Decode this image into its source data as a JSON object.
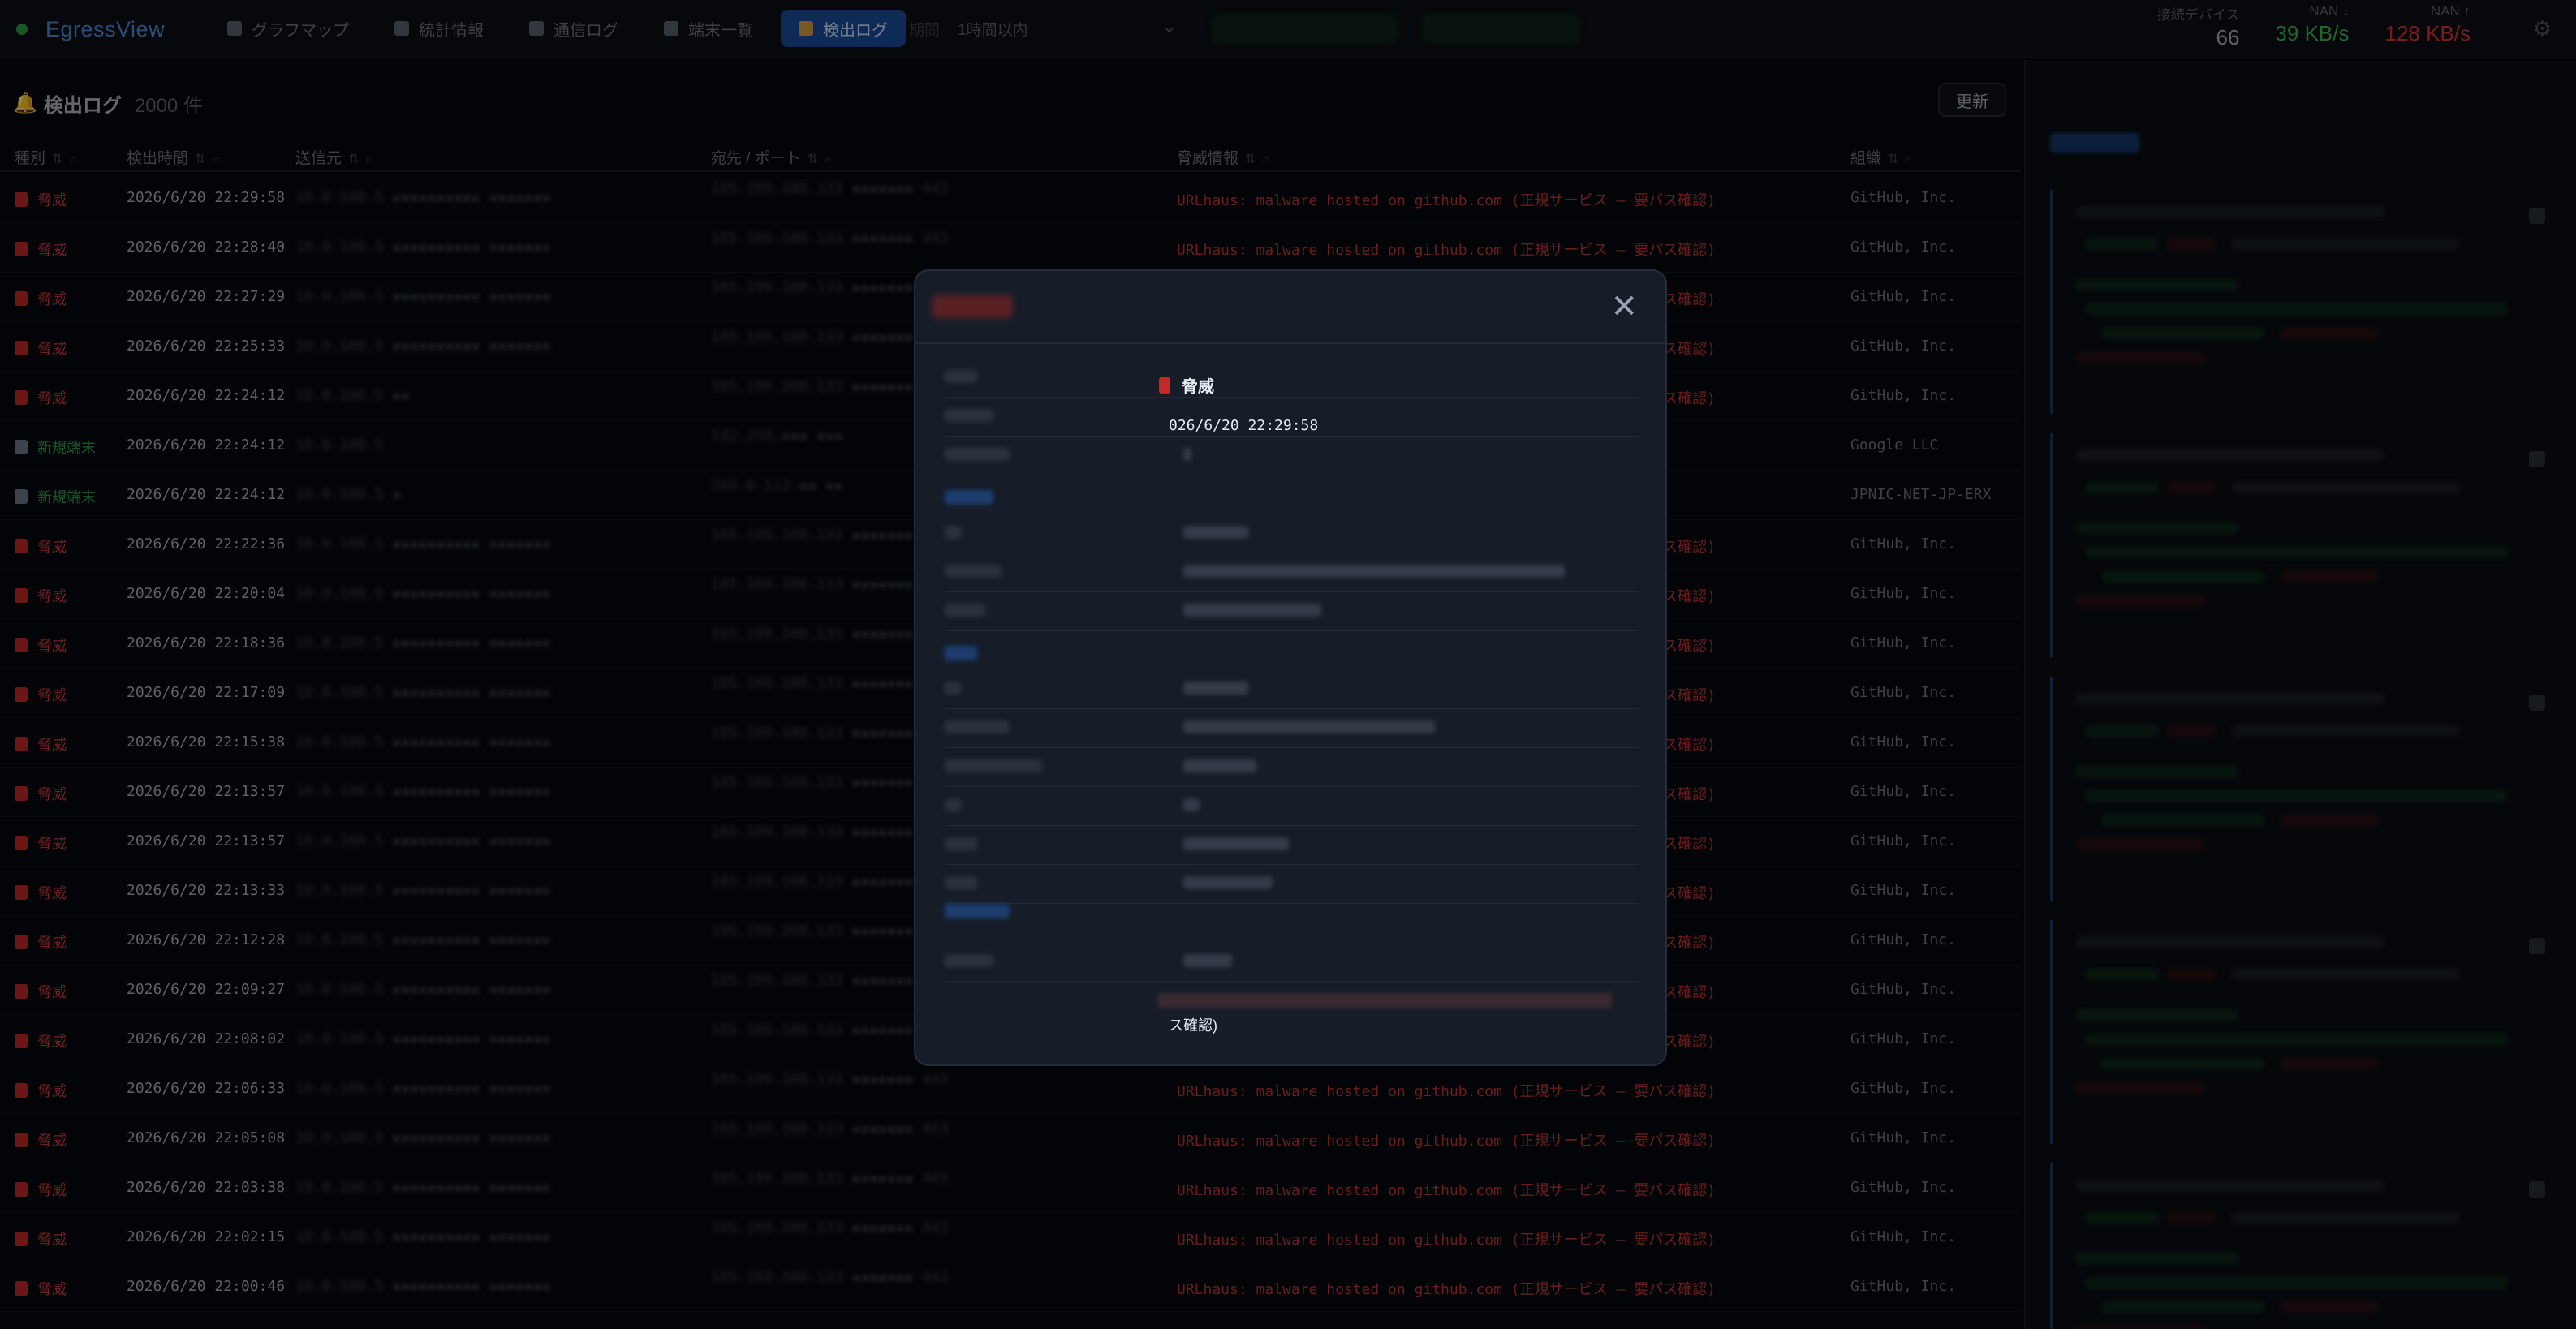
{
  "app": {
    "name": "EgressView"
  },
  "nav": {
    "tabs": [
      {
        "label": "グラフマップ",
        "active": false
      },
      {
        "label": "統計情報",
        "active": false
      },
      {
        "label": "通信ログ",
        "active": false
      },
      {
        "label": "端末一覧",
        "active": false
      },
      {
        "label": "検出ログ",
        "active": true
      }
    ],
    "period_label": "期間",
    "period_value": "1時間以内"
  },
  "stats": {
    "devices_label": "接続デバイス",
    "devices_value": "66",
    "down_label": "NAN ↓",
    "down_value": "39 KB/s",
    "up_label": "NAN ↑",
    "up_value": "128 KB/s",
    "colors": {
      "down": "#3fb950",
      "up": "#da3633"
    }
  },
  "log": {
    "title": "検出ログ",
    "count": "2000 件",
    "refresh_label": "更新",
    "columns": [
      "種別",
      "検出時間",
      "送信元",
      "宛先 / ポート",
      "脅威情報",
      "組織"
    ],
    "rows": [
      {
        "type": "脅威",
        "kind": "threat",
        "time": "2026/6/20 22:29:58",
        "src": "10.0.100.5 ▪▪▪▪▪▪▪▪▪▪ ▪▪▪▪▪▪▪",
        "dst": "185.199.108.133 ▪▪▪▪▪▪▪ 443",
        "info": "URLhaus: malware hosted on github.com (正規サービス ― 要パス確認)",
        "org": "GitHub, Inc."
      },
      {
        "type": "脅威",
        "kind": "threat",
        "time": "2026/6/20 22:28:40",
        "src": "10.0.100.5 ▪▪▪▪▪▪▪▪▪▪ ▪▪▪▪▪▪▪",
        "dst": "185.199.108.133 ▪▪▪▪▪▪▪ 443",
        "info": "URLhaus: malware hosted on github.com (正規サービス ― 要パス確認)",
        "org": "GitHub, Inc."
      },
      {
        "type": "脅威",
        "kind": "threat",
        "time": "2026/6/20 22:27:29",
        "src": "10.0.100.5 ▪▪▪▪▪▪▪▪▪▪ ▪▪▪▪▪▪▪",
        "dst": "185.199.108.133 ▪▪▪▪▪▪▪ 443",
        "info": "URLhaus: malware hosted on github.com (正規サービス ― 要パス確認)",
        "org": "GitHub, Inc."
      },
      {
        "type": "脅威",
        "kind": "threat",
        "time": "2026/6/20 22:25:33",
        "src": "10.0.100.5 ▪▪▪▪▪▪▪▪▪▪ ▪▪▪▪▪▪▪",
        "dst": "185.199.108.133 ▪▪▪▪▪▪▪ 443",
        "info": "URLhaus: malware hosted on github.com (正規サービス ― 要パス確認)",
        "org": "GitHub, Inc."
      },
      {
        "type": "脅威",
        "kind": "threat",
        "time": "2026/6/20 22:24:12",
        "src": "10.0.100.5 ▪▪",
        "dst": "185.199.108.133 ▪▪▪▪▪▪▪ 443",
        "info": "URLhaus: malware hosted on github.com (正規サービス ― 要パス確認)",
        "org": "GitHub, Inc."
      },
      {
        "type": "新規端末",
        "kind": "new",
        "time": "2026/6/20 22:24:12",
        "src": "10.0.100.5",
        "dst": "142.250.▪▪▪ ▪▪▪",
        "info": "",
        "org": "Google LLC"
      },
      {
        "type": "新規端末",
        "kind": "new",
        "time": "2026/6/20 22:24:12",
        "src": "10.0.100.5 ▪",
        "dst": "203.0.113.▪▪ ▪▪",
        "info": "",
        "org": "JPNIC-NET-JP-ERX"
      },
      {
        "type": "脅威",
        "kind": "threat",
        "time": "2026/6/20 22:22:36",
        "src": "10.0.100.5 ▪▪▪▪▪▪▪▪▪▪ ▪▪▪▪▪▪▪",
        "dst": "185.199.108.133 ▪▪▪▪▪▪▪ 443",
        "info": "URLhaus: malware hosted on github.com (正規サービス ― 要パス確認)",
        "org": "GitHub, Inc."
      },
      {
        "type": "脅威",
        "kind": "threat",
        "time": "2026/6/20 22:20:04",
        "src": "10.0.100.5 ▪▪▪▪▪▪▪▪▪▪ ▪▪▪▪▪▪▪",
        "dst": "185.199.108.133 ▪▪▪▪▪▪▪ 443",
        "info": "URLhaus: malware hosted on github.com (正規サービス ― 要パス確認)",
        "org": "GitHub, Inc."
      },
      {
        "type": "脅威",
        "kind": "threat",
        "time": "2026/6/20 22:18:36",
        "src": "10.0.100.5 ▪▪▪▪▪▪▪▪▪▪ ▪▪▪▪▪▪▪",
        "dst": "185.199.108.133 ▪▪▪▪▪▪▪ 443",
        "info": "URLhaus: malware hosted on github.com (正規サービス ― 要パス確認)",
        "org": "GitHub, Inc."
      },
      {
        "type": "脅威",
        "kind": "threat",
        "time": "2026/6/20 22:17:09",
        "src": "10.0.100.5 ▪▪▪▪▪▪▪▪▪▪ ▪▪▪▪▪▪▪",
        "dst": "185.199.108.133 ▪▪▪▪▪▪▪ 443",
        "info": "URLhaus: malware hosted on github.com (正規サービス ― 要パス確認)",
        "org": "GitHub, Inc."
      },
      {
        "type": "脅威",
        "kind": "threat",
        "time": "2026/6/20 22:15:38",
        "src": "10.0.100.5 ▪▪▪▪▪▪▪▪▪▪ ▪▪▪▪▪▪▪",
        "dst": "185.199.108.133 ▪▪▪▪▪▪▪ 443",
        "info": "URLhaus: malware hosted on github.com (正規サービス ― 要パス確認)",
        "org": "GitHub, Inc."
      },
      {
        "type": "脅威",
        "kind": "threat",
        "time": "2026/6/20 22:13:57",
        "src": "10.0.100.5 ▪▪▪▪▪▪▪▪▪▪ ▪▪▪▪▪▪▪",
        "dst": "185.199.108.133 ▪▪▪▪▪▪▪ 443",
        "info": "URLhaus: malware hosted on github.com (正規サービス ― 要パス確認)",
        "org": "GitHub, Inc."
      },
      {
        "type": "脅威",
        "kind": "threat",
        "time": "2026/6/20 22:13:57",
        "src": "10.0.100.5 ▪▪▪▪▪▪▪▪▪▪ ▪▪▪▪▪▪▪",
        "dst": "185.199.108.133 ▪▪▪▪▪▪▪ 443",
        "info": "URLhaus: malware hosted on github.com (正規サービス ― 要パス確認)",
        "org": "GitHub, Inc."
      },
      {
        "type": "脅威",
        "kind": "threat",
        "time": "2026/6/20 22:13:33",
        "src": "10.0.100.5 ▪▪▪▪▪▪▪▪▪▪ ▪▪▪▪▪▪▪",
        "dst": "185.199.108.133 ▪▪▪▪▪▪▪ 443",
        "info": "URLhaus: malware hosted on github.com (正規サービス ― 要パス確認)",
        "org": "GitHub, Inc."
      },
      {
        "type": "脅威",
        "kind": "threat",
        "time": "2026/6/20 22:12:28",
        "src": "10.0.100.5 ▪▪▪▪▪▪▪▪▪▪ ▪▪▪▪▪▪▪",
        "dst": "185.199.108.133 ▪▪▪▪▪▪▪ 443",
        "info": "URLhaus: malware hosted on github.com (正規サービス ― 要パス確認)",
        "org": "GitHub, Inc."
      },
      {
        "type": "脅威",
        "kind": "threat",
        "time": "2026/6/20 22:09:27",
        "src": "10.0.100.5 ▪▪▪▪▪▪▪▪▪▪ ▪▪▪▪▪▪▪",
        "dst": "185.199.108.133 ▪▪▪▪▪▪▪ 443",
        "info": "URLhaus: malware hosted on github.com (正規サービス ― 要パス確認)",
        "org": "GitHub, Inc."
      },
      {
        "type": "脅威",
        "kind": "threat",
        "time": "2026/6/20 22:08:02",
        "src": "10.0.100.5 ▪▪▪▪▪▪▪▪▪▪ ▪▪▪▪▪▪▪",
        "dst": "185.199.108.133 ▪▪▪▪▪▪▪ 443",
        "info": "URLhaus: malware hosted on github.com (正規サービス ― 要パス確認)",
        "org": "GitHub, Inc."
      },
      {
        "type": "脅威",
        "kind": "threat",
        "time": "2026/6/20 22:06:33",
        "src": "10.0.100.5 ▪▪▪▪▪▪▪▪▪▪ ▪▪▪▪▪▪▪",
        "dst": "185.199.108.133 ▪▪▪▪▪▪▪ 443",
        "info": "URLhaus: malware hosted on github.com (正規サービス ― 要パス確認)",
        "org": "GitHub, Inc."
      },
      {
        "type": "脅威",
        "kind": "threat",
        "time": "2026/6/20 22:05:08",
        "src": "10.0.100.5 ▪▪▪▪▪▪▪▪▪▪ ▪▪▪▪▪▪▪",
        "dst": "185.199.108.133 ▪▪▪▪▪▪▪ 443",
        "info": "URLhaus: malware hosted on github.com (正規サービス ― 要パス確認)",
        "org": "GitHub, Inc."
      },
      {
        "type": "脅威",
        "kind": "threat",
        "time": "2026/6/20 22:03:38",
        "src": "10.0.100.5 ▪▪▪▪▪▪▪▪▪▪ ▪▪▪▪▪▪▪",
        "dst": "185.199.108.133 ▪▪▪▪▪▪▪ 443",
        "info": "URLhaus: malware hosted on github.com (正規サービス ― 要パス確認)",
        "org": "GitHub, Inc."
      },
      {
        "type": "脅威",
        "kind": "threat",
        "time": "2026/6/20 22:02:15",
        "src": "10.0.100.5 ▪▪▪▪▪▪▪▪▪▪ ▪▪▪▪▪▪▪",
        "dst": "185.199.108.133 ▪▪▪▪▪▪▪ 443",
        "info": "URLhaus: malware hosted on github.com (正規サービス ― 要パス確認)",
        "org": "GitHub, Inc."
      },
      {
        "type": "脅威",
        "kind": "threat",
        "time": "2026/6/20 22:00:46",
        "src": "10.0.100.5 ▪▪▪▪▪▪▪▪▪▪ ▪▪▪▪▪▪▪",
        "dst": "185.199.108.133 ▪▪▪▪▪▪▪ 443",
        "info": "URLhaus: malware hosted on github.com (正規サービス ― 要パス確認)",
        "org": "GitHub, Inc."
      }
    ]
  },
  "modal": {
    "type_value": "脅威",
    "time_value": "026/6/20 22:29:58",
    "info_wrap": "ス確認)",
    "close_icon": "close-icon"
  },
  "colors": {
    "threat": "#d63b3b",
    "new_device": "#2f9a4c",
    "accent": "#1a4fa0",
    "brand": "#4c8fd6"
  }
}
